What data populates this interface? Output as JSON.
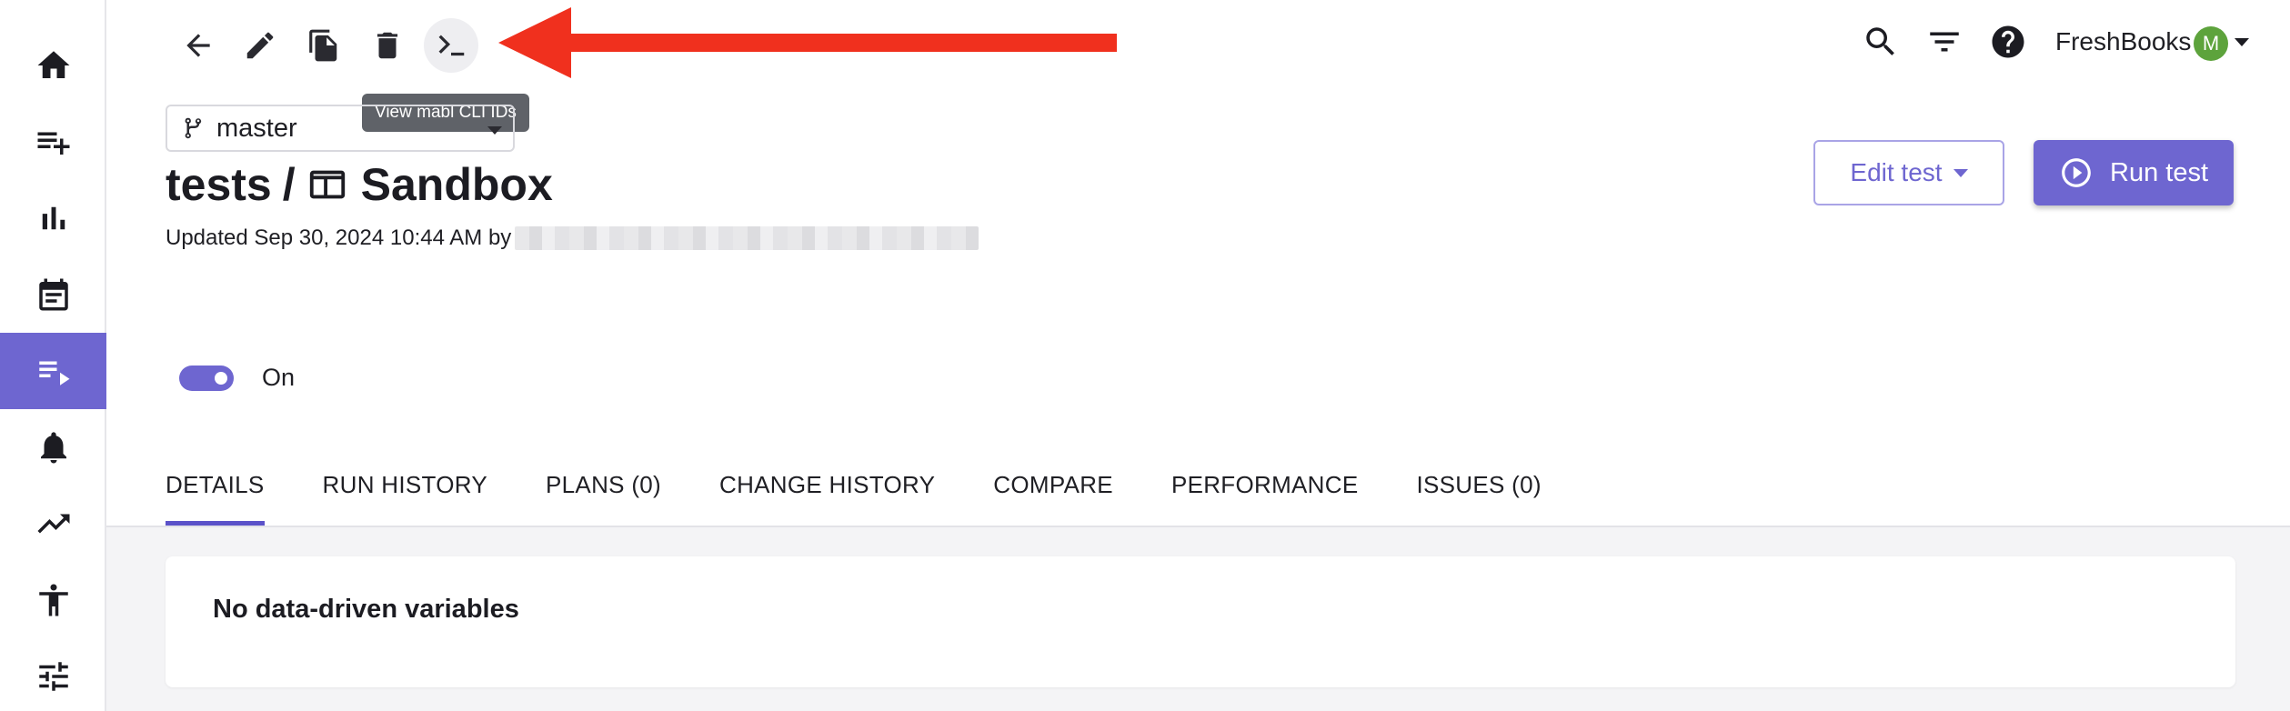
{
  "sidebar": {
    "items": [
      {
        "icon": "home-icon"
      },
      {
        "icon": "playlist-add-icon"
      },
      {
        "icon": "bar-chart-icon"
      },
      {
        "icon": "calendar-icon"
      },
      {
        "icon": "test-list-icon",
        "active": true
      },
      {
        "icon": "bell-icon"
      },
      {
        "icon": "trending-up-icon"
      },
      {
        "icon": "accessibility-icon"
      },
      {
        "icon": "tune-icon"
      }
    ]
  },
  "toolbar": {
    "icons": [
      "back-arrow-icon",
      "edit-icon",
      "copy-icon",
      "delete-icon",
      "terminal-icon"
    ],
    "tooltip": "View mabl CLI IDs"
  },
  "header": {
    "org_name": "FreshBooks",
    "avatar_initial": "M"
  },
  "branch": {
    "name": "master"
  },
  "page": {
    "breadcrumb": "tests",
    "separator": "/",
    "title": "Sandbox",
    "updated": "Updated Sep 30, 2024 10:44 AM by"
  },
  "actions": {
    "edit_label": "Edit test",
    "run_label": "Run test"
  },
  "toggle": {
    "label": "On",
    "enabled": true
  },
  "tabs": [
    {
      "label": "DETAILS",
      "active": true
    },
    {
      "label": "RUN HISTORY"
    },
    {
      "label": "PLANS (0)"
    },
    {
      "label": "CHANGE HISTORY"
    },
    {
      "label": "COMPARE"
    },
    {
      "label": "PERFORMANCE"
    },
    {
      "label": "ISSUES (0)"
    }
  ],
  "details": {
    "message": "No data-driven variables"
  },
  "colors": {
    "accent": "#6e66d0",
    "annotation_arrow": "#f0301e",
    "avatar": "#5da33c"
  }
}
